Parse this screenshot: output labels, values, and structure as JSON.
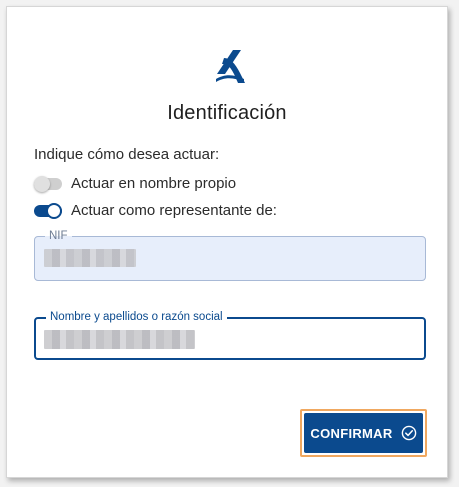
{
  "dialog": {
    "title": "Identificación",
    "prompt": "Indique cómo desea actuar:"
  },
  "options": [
    {
      "label": "Actuar en nombre propio",
      "checked": false
    },
    {
      "label": "Actuar como representante de:",
      "checked": true
    }
  ],
  "fields": {
    "nif": {
      "legend": "NIF",
      "value": ""
    },
    "name": {
      "legend": "Nombre y apellidos o razón social",
      "value": ""
    }
  },
  "confirm": {
    "label": "CONFIRMAR",
    "icon": "check-circle-icon"
  },
  "colors": {
    "primary": "#0b4a8e",
    "focus_outline": "#f0a860",
    "field_disabled_bg": "#e7eefb"
  },
  "logo": {
    "icon": "agency-logo-icon"
  }
}
